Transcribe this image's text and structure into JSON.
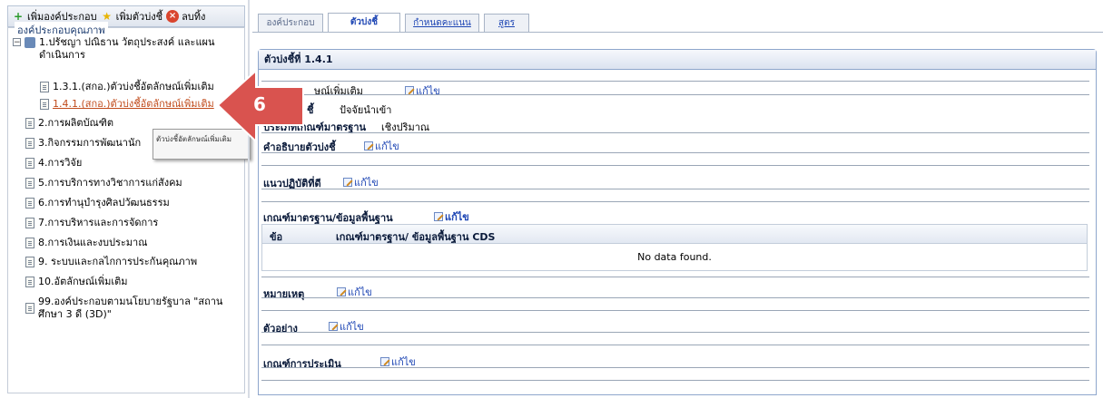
{
  "toolbar": {
    "add_component": "เพิ่มองค์ประกอบ",
    "add_indicator": "เพิ่มตัวบ่งชี้",
    "delete": "ลบทิ้ง"
  },
  "tree": {
    "legend": "องค์ประกอบคุณภาพ",
    "root": {
      "label_line1": "1.ปรัชญา ปณิธาน วัตถุประสงค์ และแผน",
      "label_line2": "ดำเนินการ"
    },
    "children": [
      "1.3.1.(สกอ.)ตัวบ่งชี้อัตลักษณ์เพิ่มเติม",
      "1.4.1.(สกอ.)ตัวบ่งชี้อัตลักษณ์เพิ่มเติม"
    ],
    "items": [
      "2.การผลิตบัณฑิต",
      "3.กิจกรรมการพัฒนานัก",
      "4.การวิจัย",
      "5.การบริการทางวิชาการแก่สังคม",
      "6.การทำนุบำรุงศิลปวัฒนธรรม",
      "7.การบริหารและการจัดการ",
      "8.การเงินและงบประมาณ",
      "9. ระบบและกลไกการประกันคุณภาพ",
      "10.อัตลักษณ์เพิ่มเติม"
    ],
    "last_item_line1": "99.องค์ประกอบตามนโยบายรัฐบาล \"สถาน",
    "last_item_line2": "ศึกษา 3 ดี (3D)\"",
    "tooltip": "ตัวบ่งชี้อัตลักษณ์เพิ่มเติม"
  },
  "callout": {
    "number": "6",
    "color": "#d9534f"
  },
  "tabs": [
    "องค์ประกอบ",
    "ตัวบ่งชี้",
    "กำหนดคะแนน",
    "สูตร"
  ],
  "panel": {
    "title": "ตัวบ่งชี้ที่  1.4.1",
    "name_value": "ษณ์เพิ่มเติม",
    "type_label_partial": "ชี้",
    "type_value": "ปัจจัยนำเข้า",
    "criteria_type_label": "ประเภทเกณฑ์มาตรฐาน",
    "criteria_type_value": "เชิงปริมาณ",
    "description_label": "คำอธิบายตัวบ่งชี้",
    "best_practice_label": "แนวปฏิบัติที่ดี",
    "standard_label": "เกณฑ์มาตรฐาน/ข้อมูลพื้นฐาน",
    "grid": {
      "col1": "ข้อ",
      "col2": "เกณฑ์มาตรฐาน/ ข้อมูลพื้นฐาน CDS",
      "empty": "No data found."
    },
    "note_label": "หมายเหตุ",
    "example_label": "ตัวอย่าง",
    "evaluation_label": "เกณฑ์การประเมิน",
    "edit_label": "แก้ไข"
  }
}
